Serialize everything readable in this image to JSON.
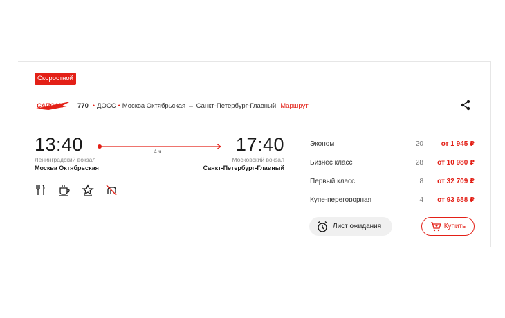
{
  "badge": "Скоростной",
  "route": {
    "train_number": "770",
    "carrier": "ДОСС",
    "from": "Москва Октябрьская",
    "arrow": "→",
    "to": "Санкт-Петербург-Главный",
    "link": "Маршрут"
  },
  "departure": {
    "time": "13:40",
    "station_sub": "Ленинградский вокзал",
    "station": "Москва Октябрьская"
  },
  "arrival": {
    "time": "17:40",
    "station_sub": "Московский вокзал",
    "station": "Санкт-Петербург-Главный"
  },
  "duration": "4 ч",
  "amenities": [
    "restaurant-icon",
    "coffee-icon",
    "star-icon",
    "no-pets-icon"
  ],
  "fares": [
    {
      "name": "Эконом",
      "count": "20",
      "price": "от 1 945 ₽"
    },
    {
      "name": "Бизнес класс",
      "count": "28",
      "price": "от 10 980 ₽"
    },
    {
      "name": "Первый класс",
      "count": "8",
      "price": "от 32 709 ₽"
    },
    {
      "name": "Купе-переговорная",
      "count": "4",
      "price": "от 93 688 ₽"
    }
  ],
  "buttons": {
    "waitlist": "Лист ожидания",
    "buy": "Купить"
  },
  "colors": {
    "accent": "#e32017",
    "text": "#1a1a1a",
    "muted": "#888888"
  }
}
